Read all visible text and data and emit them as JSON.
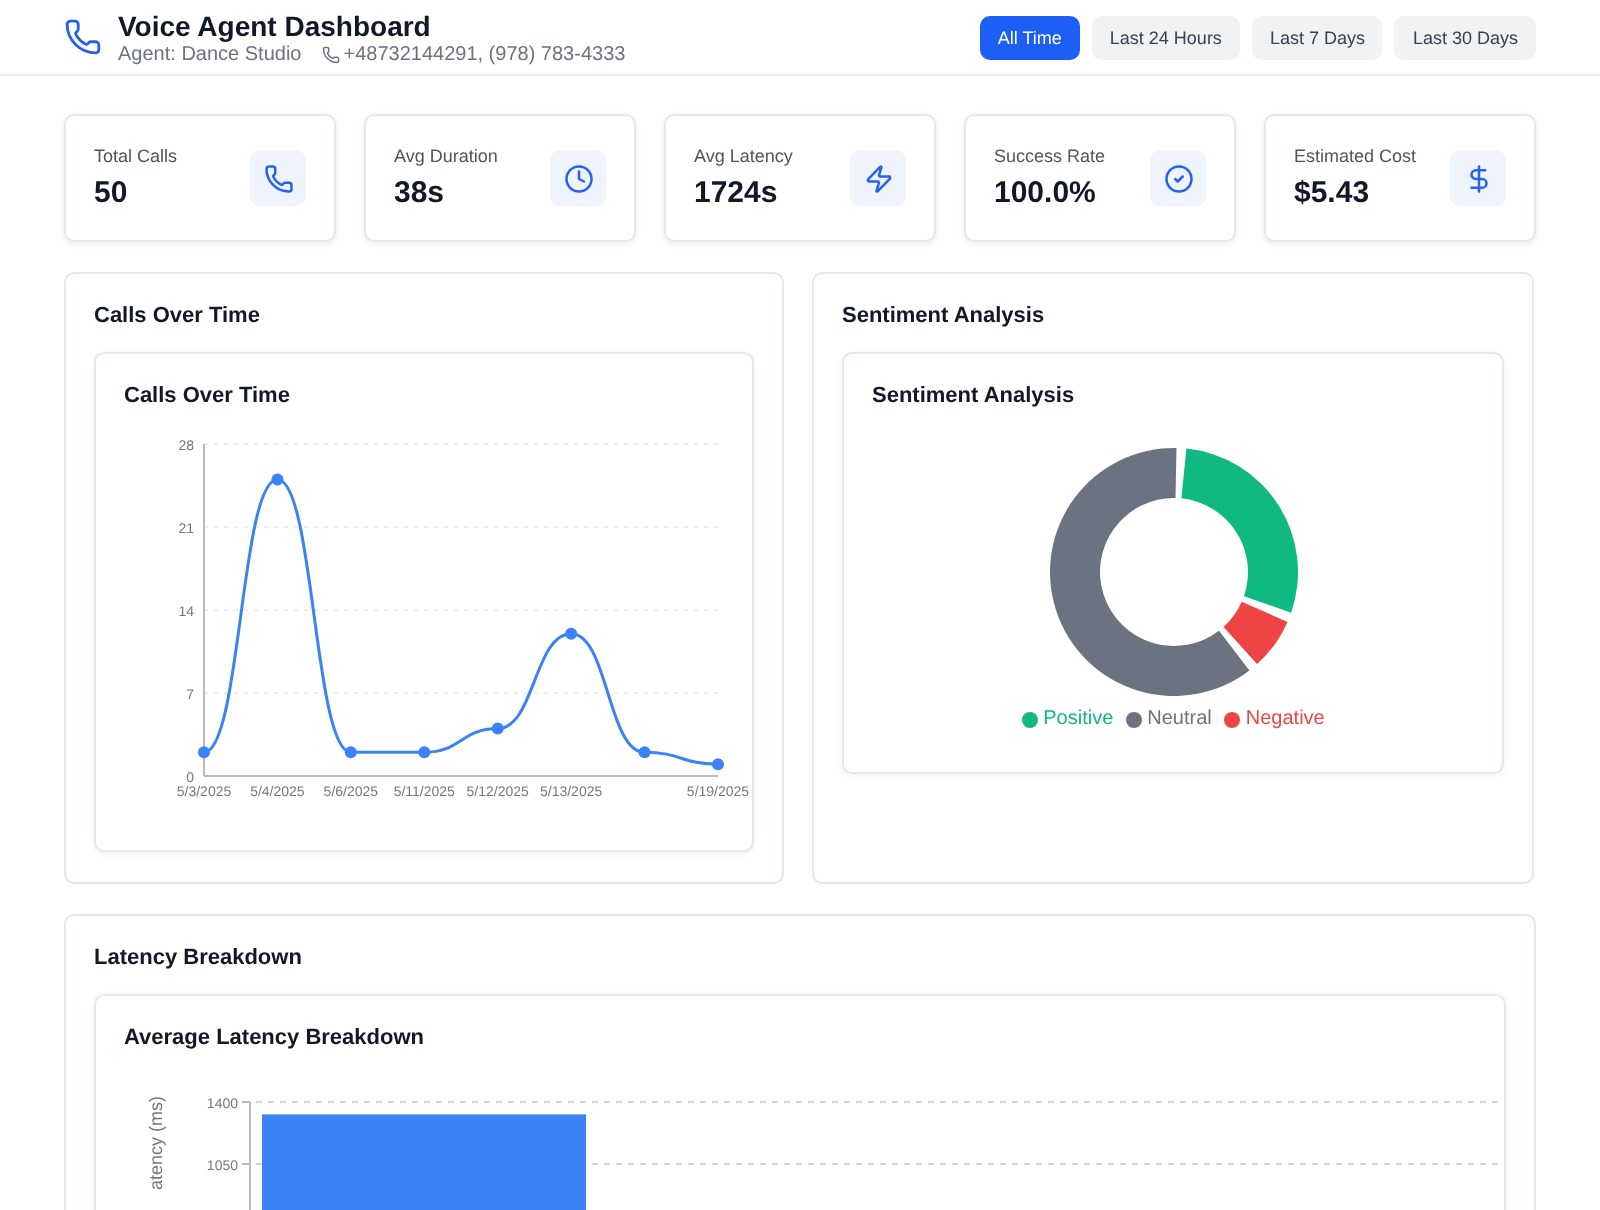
{
  "header": {
    "title": "Voice Agent Dashboard",
    "agent": "Agent: Dance Studio",
    "phones": "+48732144291, (978) 783-4333"
  },
  "time_filters": [
    {
      "label": "All Time",
      "selected": true
    },
    {
      "label": "Last 24 Hours",
      "selected": false
    },
    {
      "label": "Last 7 Days",
      "selected": false
    },
    {
      "label": "Last 30 Days",
      "selected": false
    }
  ],
  "stats": [
    {
      "kind": "calls",
      "label": "Total Calls",
      "value": "50"
    },
    {
      "kind": "duration",
      "label": "Avg Duration",
      "value": "38s"
    },
    {
      "kind": "latency",
      "label": "Avg Latency",
      "value": "1724s"
    },
    {
      "kind": "success",
      "label": "Success Rate",
      "value": "100.0%"
    },
    {
      "kind": "cost",
      "label": "Estimated Cost",
      "value": "$5.43"
    }
  ],
  "calls_panel": {
    "title": "Calls Over Time",
    "card_title": "Calls Over Time",
    "chart_data": {
      "type": "line",
      "categories": [
        "5/3/2025",
        "5/4/2025",
        "5/6/2025",
        "5/11/2025",
        "5/12/2025",
        "5/13/2025",
        null,
        "5/19/2025"
      ],
      "series": [
        {
          "color": "#3b82f6",
          "marker": true,
          "values": [
            2,
            25,
            2,
            2,
            4,
            12,
            2,
            1
          ]
        }
      ],
      "ylim": [
        0,
        28
      ],
      "yticks": [
        0,
        7,
        14,
        21,
        28
      ],
      "grid": true
    }
  },
  "sentiment_panel": {
    "title": "Sentiment Analysis",
    "card_title": "Sentiment Analysis",
    "legend": [
      {
        "label": "Positive",
        "color": "#10b981"
      },
      {
        "label": "Neutral",
        "color": "#6b7280"
      },
      {
        "label": "Negative",
        "color": "#ef4444"
      }
    ]
  },
  "latency_panel": {
    "title": "Latency Breakdown",
    "card_title": "Average Latency Breakdown",
    "chart_data": {
      "type": "bar",
      "ylabel": "atency (ms)",
      "values": [
        1330
      ],
      "ylim": [
        0,
        1400
      ],
      "yticks": [
        1050,
        1400
      ],
      "grid": true
    }
  }
}
